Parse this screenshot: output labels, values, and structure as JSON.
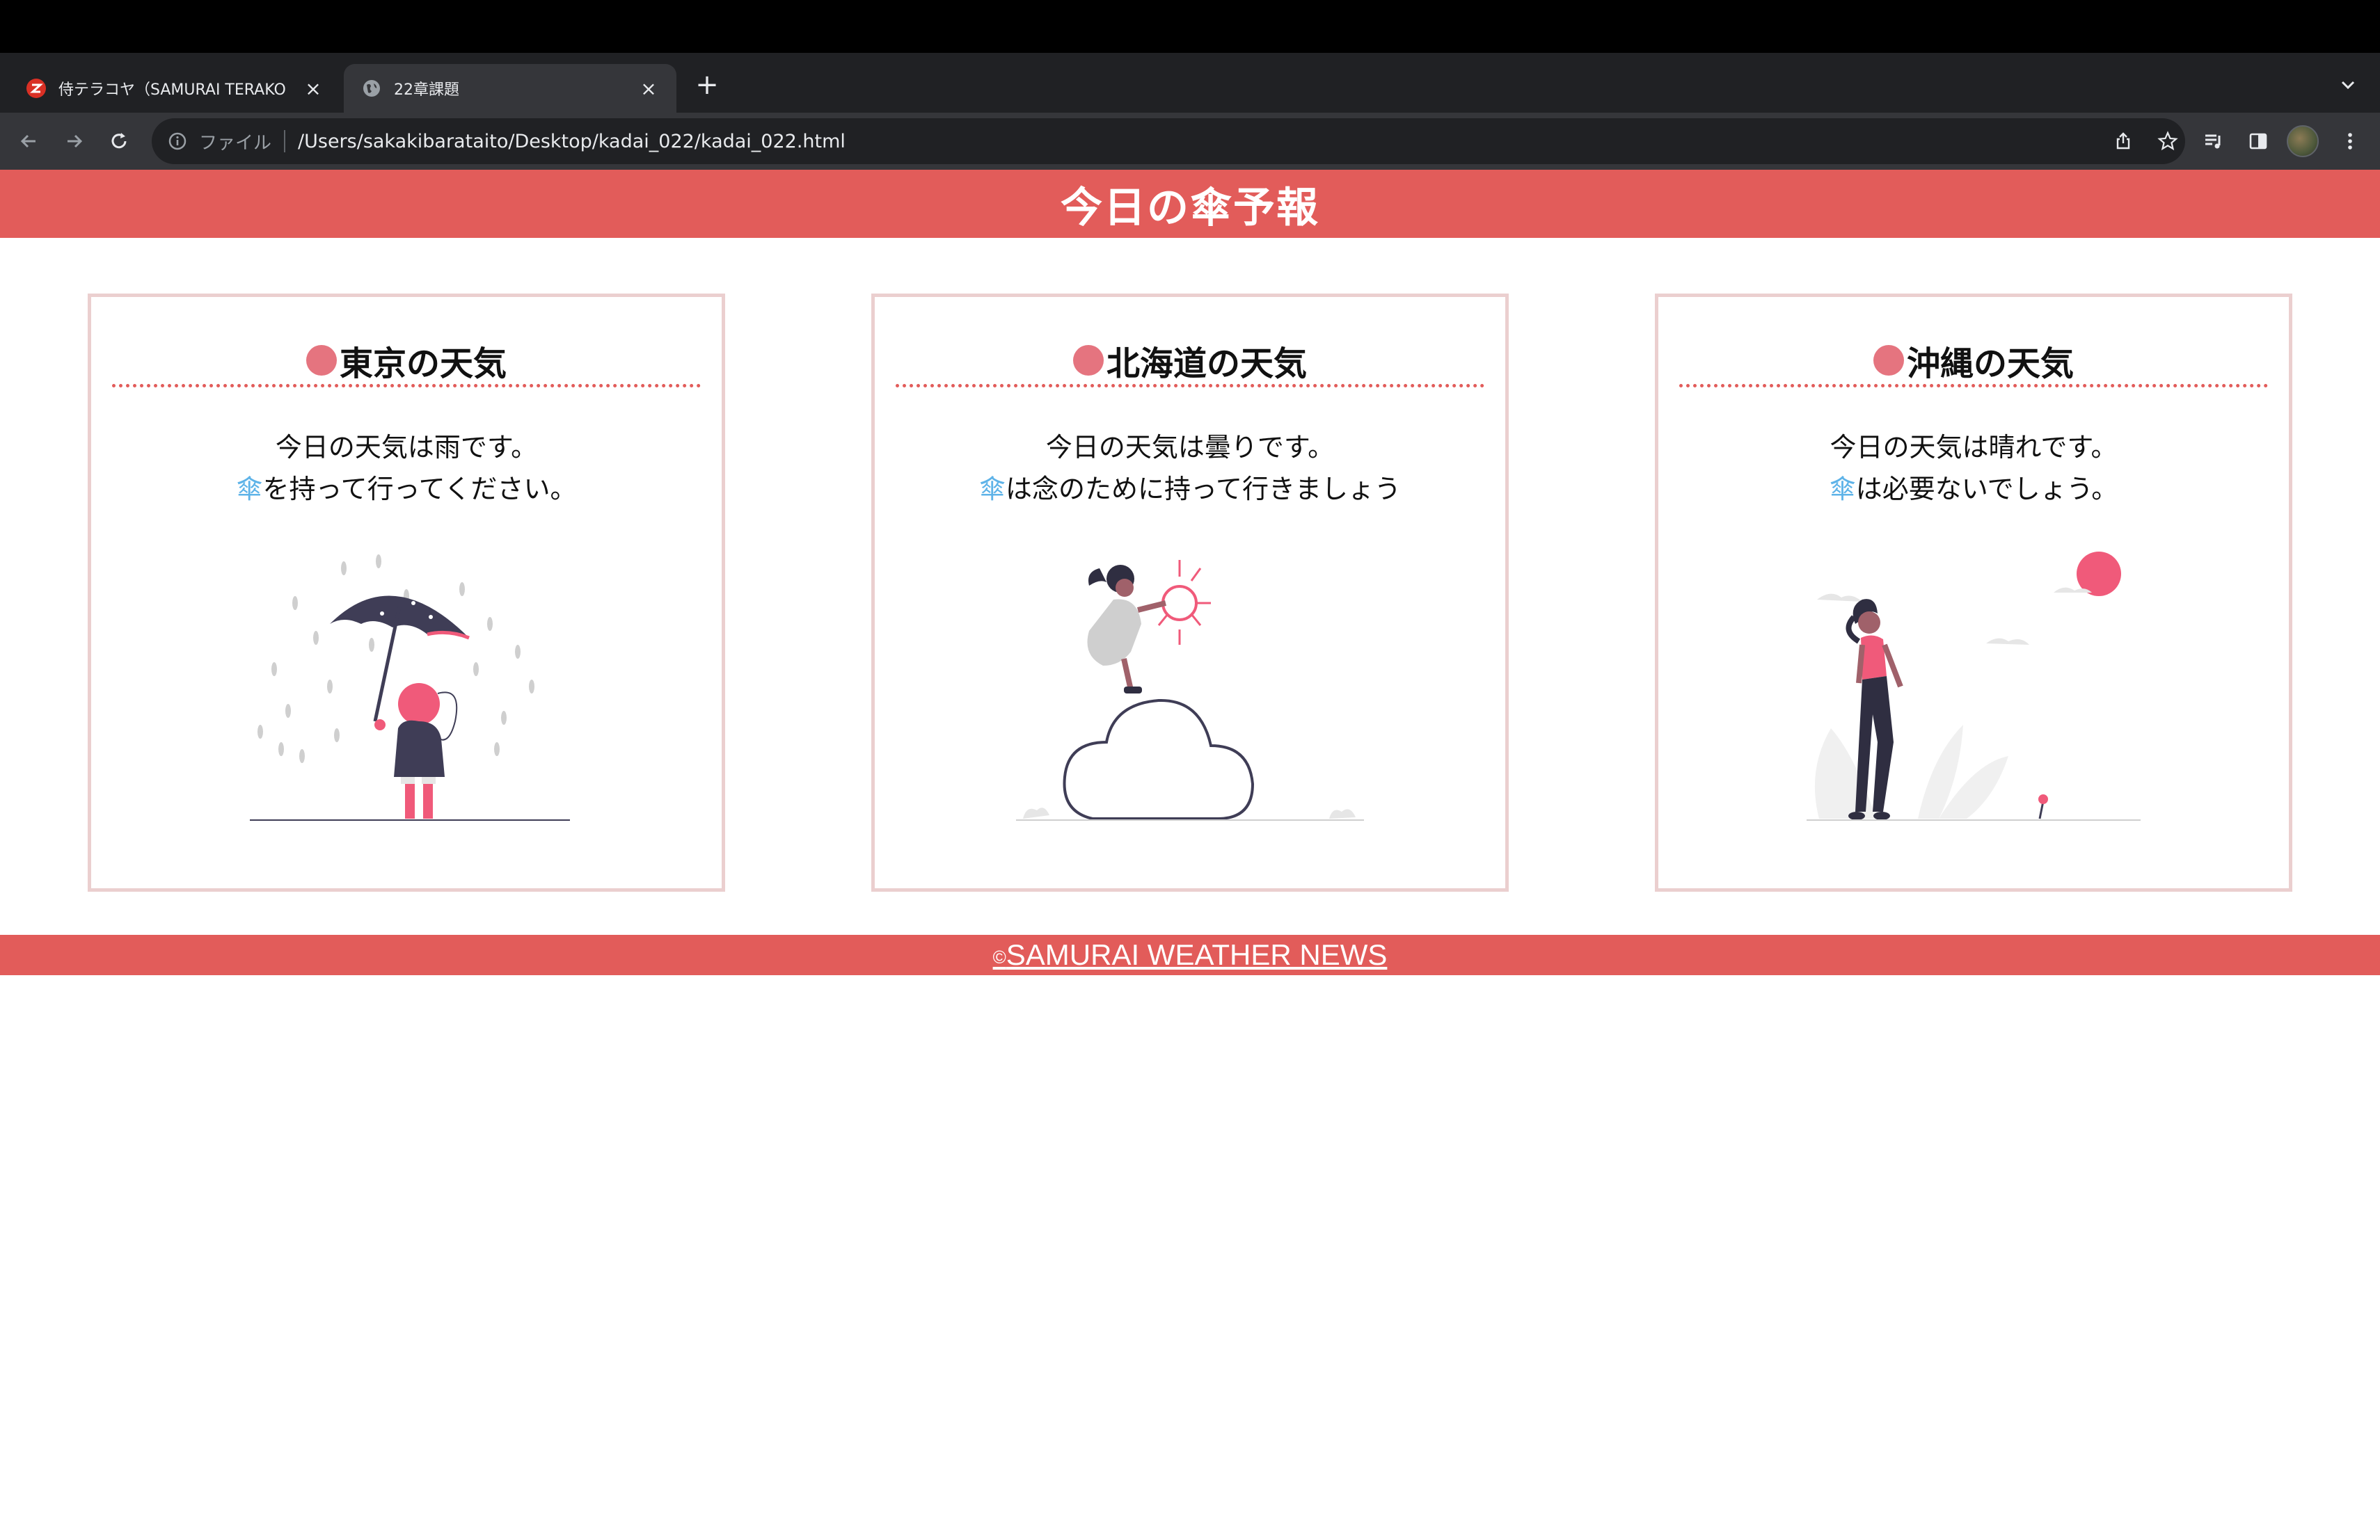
{
  "browser": {
    "tabs": [
      {
        "title": "侍テラコヤ（SAMURAI TERAKO",
        "active": false
      },
      {
        "title": "22章課題",
        "active": true
      }
    ],
    "address_scheme": "ファイル",
    "address_url": "/Users/sakakibarataito/Desktop/kadai_022/kadai_022.html"
  },
  "page": {
    "title": "今日の傘予報",
    "cards": [
      {
        "title": "東京の天気",
        "line1": "今日の天気は雨です。",
        "umbrella_word": "傘",
        "line2": "を持って行ってください。",
        "illustration": "person-with-umbrella-in-rain"
      },
      {
        "title": "北海道の天気",
        "line1": "今日の天気は曇りです。",
        "umbrella_word": "傘",
        "line2": "は念のために持って行きましょう",
        "illustration": "person-on-cloud-with-sun"
      },
      {
        "title": "沖縄の天気",
        "line1": "今日の天気は晴れです。",
        "umbrella_word": "傘",
        "line2": "は必要ないでしょう。",
        "illustration": "person-walking-sunny"
      }
    ],
    "footer": {
      "copyright_mark": "©",
      "copyright_text": "SAMURAI WEATHER NEWS"
    }
  },
  "colors": {
    "header_bg": "#e25c5a",
    "card_border": "#ebcfcf",
    "dot": "#e5747f",
    "umbrella_word": "#5eb3e8"
  }
}
